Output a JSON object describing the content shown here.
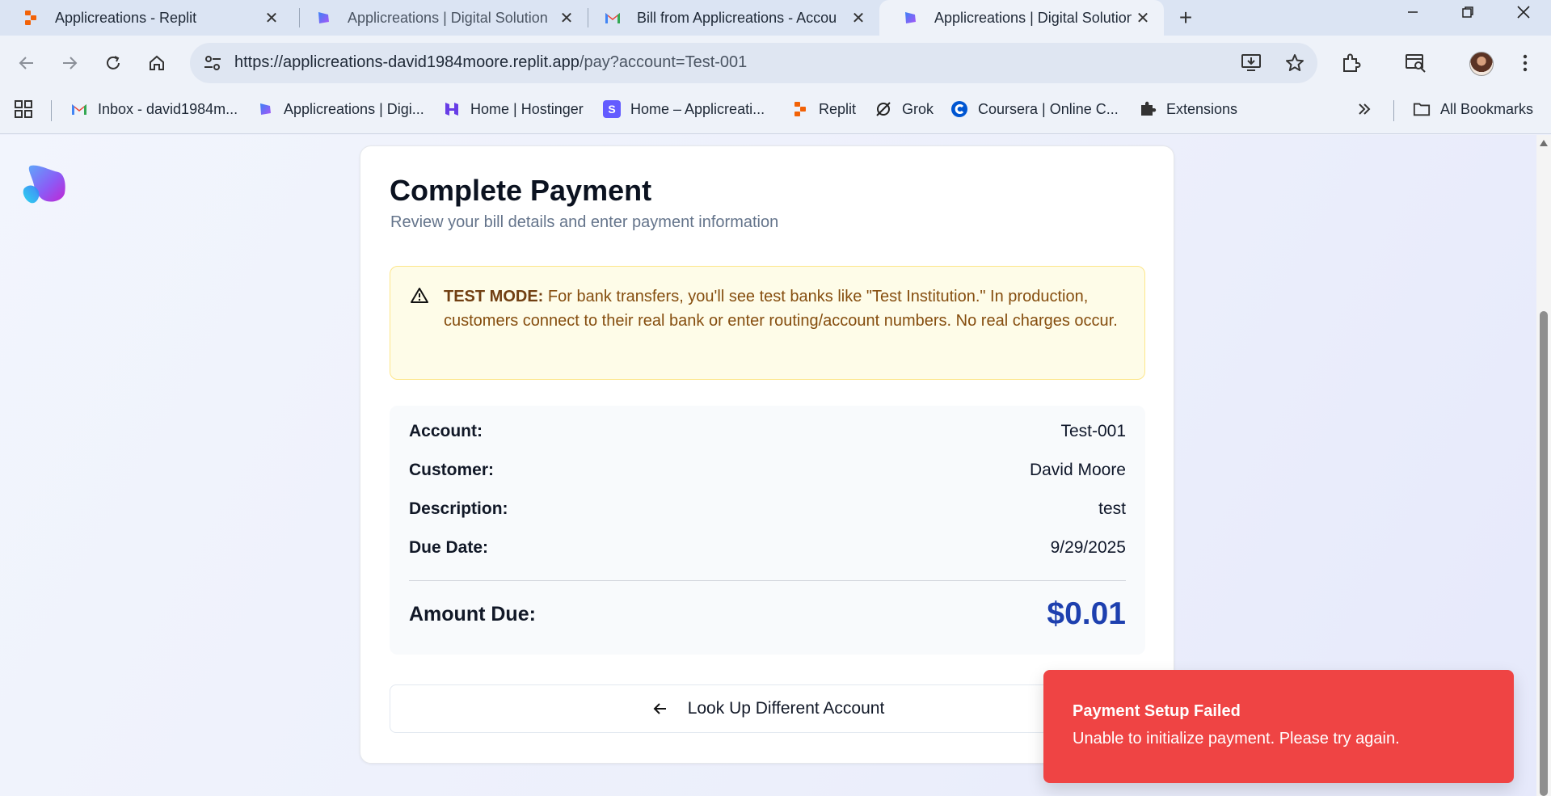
{
  "browser": {
    "tabs": [
      {
        "title": "Applicreations - Replit",
        "favicon": "replit-icon",
        "active": false
      },
      {
        "title": "Applicreations | Digital Solution",
        "favicon": "applicreations-icon",
        "active": false
      },
      {
        "title": "Bill from Applicreations - Accou",
        "favicon": "gmail-icon",
        "active": false
      },
      {
        "title": "Applicreations | Digital Solution",
        "favicon": "applicreations-icon",
        "active": true
      }
    ],
    "url_host": "https://applicreations-david1984moore.replit.app",
    "url_path": "/pay?account=Test-001",
    "bookmarks": [
      {
        "label": "Inbox - david1984m...",
        "icon": "gmail-icon"
      },
      {
        "label": "Applicreations | Digi...",
        "icon": "applicreations-icon"
      },
      {
        "label": "Home | Hostinger",
        "icon": "hostinger-icon"
      },
      {
        "label": "Home – Applicreati...",
        "icon": "stripe-icon"
      },
      {
        "label": "Replit",
        "icon": "replit-icon"
      },
      {
        "label": "Grok",
        "icon": "grok-icon"
      },
      {
        "label": "Coursera | Online C...",
        "icon": "coursera-icon"
      },
      {
        "label": "Extensions",
        "icon": "puzzle-icon"
      }
    ],
    "all_bookmarks_label": "All Bookmarks"
  },
  "page": {
    "title": "Complete Payment",
    "subtitle": "Review your bill details and enter payment information",
    "alert": {
      "label": "TEST MODE:",
      "text": "For bank transfers, you'll see test banks like \"Test Institution.\" In production, customers connect to their real bank or enter routing/account numbers. No real charges occur."
    },
    "details": [
      {
        "key": "Account:",
        "value": "Test-001"
      },
      {
        "key": "Customer:",
        "value": "David Moore"
      },
      {
        "key": "Description:",
        "value": "test"
      },
      {
        "key": "Due Date:",
        "value": "9/29/2025"
      }
    ],
    "amount_label": "Amount Due:",
    "amount_value": "$0.01",
    "lookup_button": "Look Up Different Account"
  },
  "toast": {
    "title": "Payment Setup Failed",
    "message": "Unable to initialize payment. Please try again."
  },
  "colors": {
    "accent": "#1e40af",
    "toast_bg": "#ef4444",
    "alert_bg": "#fefce8",
    "alert_text": "#854d0e"
  }
}
